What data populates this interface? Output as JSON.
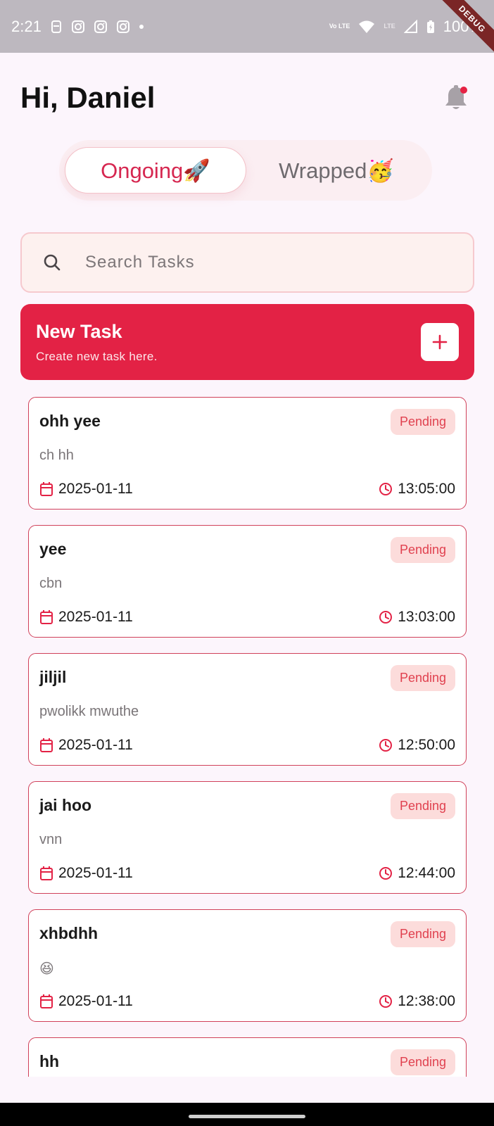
{
  "status_bar": {
    "time": "2:21",
    "battery": "100%",
    "debug_label": "DEBUG",
    "network_lte1": "Vo LTE",
    "network_lte2": "LTE"
  },
  "header": {
    "greeting": "Hi, Daniel"
  },
  "tabs": [
    {
      "label": "Ongoing🚀",
      "active": true
    },
    {
      "label": "Wrapped🥳",
      "active": false
    }
  ],
  "search": {
    "placeholder": "Search Tasks"
  },
  "new_task": {
    "title": "New Task",
    "subtitle": "Create new task here."
  },
  "tasks": [
    {
      "title": "ohh yee",
      "description": "ch hh",
      "status": "Pending",
      "date": "2025-01-11",
      "time": "13:05:00"
    },
    {
      "title": "yee",
      "description": "cbn",
      "status": "Pending",
      "date": "2025-01-11",
      "time": "13:03:00"
    },
    {
      "title": "jiljil",
      "description": "pwolikk mwuthe",
      "status": "Pending",
      "date": "2025-01-11",
      "time": "12:50:00"
    },
    {
      "title": "jai hoo",
      "description": "vnn",
      "status": "Pending",
      "date": "2025-01-11",
      "time": "12:44:00"
    },
    {
      "title": "xhbdhh",
      "description": "😆",
      "status": "Pending",
      "date": "2025-01-11",
      "time": "12:38:00"
    },
    {
      "title": "hh",
      "description": "",
      "status": "Pending",
      "date": "",
      "time": ""
    }
  ],
  "colors": {
    "accent": "#e32245",
    "badge_bg": "#fcdcdb",
    "badge_text": "#e0414f",
    "background": "#fcf5fc"
  }
}
